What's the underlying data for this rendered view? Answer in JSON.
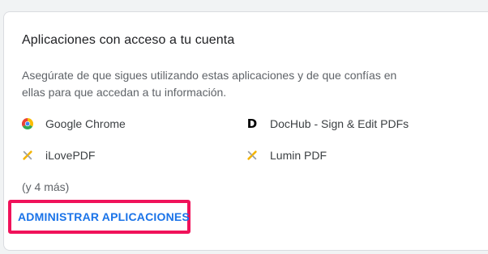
{
  "card": {
    "title": "Aplicaciones con acceso a tu cuenta",
    "description": "Asegúrate de que sigues utilizando estas aplicaciones y de que confías en ellas para que accedan a tu información."
  },
  "apps": [
    {
      "name": "Google Chrome",
      "icon": "chrome-icon"
    },
    {
      "name": "DocHub - Sign & Edit PDFs",
      "icon": "dochub-icon",
      "icon_glyph": "D"
    },
    {
      "name": "iLovePDF",
      "icon": "puzzle-icon"
    },
    {
      "name": "Lumin PDF",
      "icon": "puzzle-icon"
    }
  ],
  "more_text": "(y 4 más)",
  "manage_button": "ADMINISTRAR APLICACIONES",
  "colors": {
    "accent": "#1a73e8",
    "highlight": "#f0125a",
    "text_primary": "#202124",
    "text_secondary": "#5f6368"
  }
}
